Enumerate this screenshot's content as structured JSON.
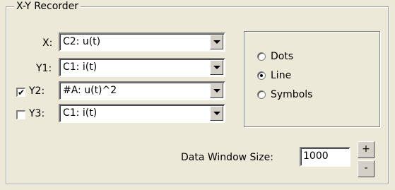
{
  "group": {
    "title": "X-Y Recorder"
  },
  "rows": [
    {
      "label": "X:",
      "value": "C2: u(t)",
      "checked": null
    },
    {
      "label": "Y1:",
      "value": "C1: i(t)",
      "checked": null
    },
    {
      "label": "Y2:",
      "value": "#A: u(t)^2",
      "checked": true
    },
    {
      "label": "Y3:",
      "value": "C1: i(t)",
      "checked": false
    }
  ],
  "plot_style": {
    "options": [
      "Dots",
      "Line",
      "Symbols"
    ],
    "selected": "Line"
  },
  "data_window": {
    "label": "Data Window Size:",
    "value": "1000",
    "increment_label": "+",
    "decrement_label": "-"
  },
  "icons": {
    "check": "✔",
    "dropdown": "chevron-down-icon"
  }
}
